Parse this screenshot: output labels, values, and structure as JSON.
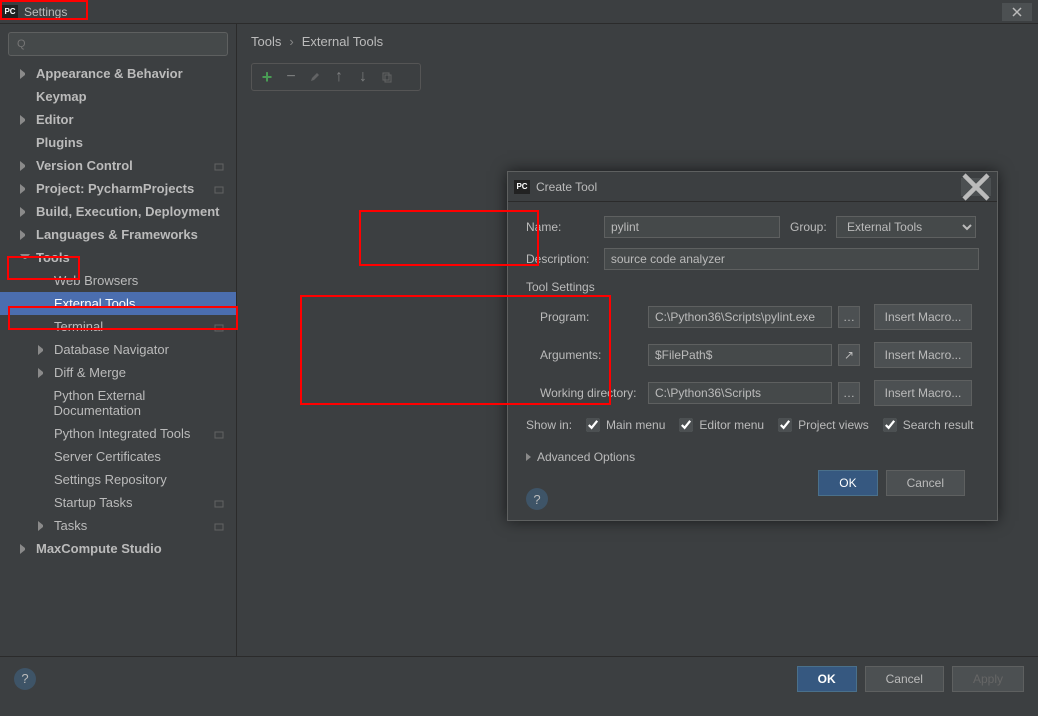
{
  "window": {
    "title": "Settings"
  },
  "sidebar": {
    "search_placeholder": "Q",
    "items": [
      {
        "label": "Appearance & Behavior",
        "bold": true,
        "arrow": "right",
        "depth": 1
      },
      {
        "label": "Keymap",
        "bold": true,
        "arrow": "none",
        "depth": 1
      },
      {
        "label": "Editor",
        "bold": true,
        "arrow": "right",
        "depth": 1
      },
      {
        "label": "Plugins",
        "bold": true,
        "arrow": "none",
        "depth": 1
      },
      {
        "label": "Version Control",
        "bold": true,
        "arrow": "right",
        "depth": 1,
        "proj": true
      },
      {
        "label": "Project: PycharmProjects",
        "bold": true,
        "arrow": "right",
        "depth": 1,
        "proj": true
      },
      {
        "label": "Build, Execution, Deployment",
        "bold": true,
        "arrow": "right",
        "depth": 1
      },
      {
        "label": "Languages & Frameworks",
        "bold": true,
        "arrow": "right",
        "depth": 1
      },
      {
        "label": "Tools",
        "bold": true,
        "arrow": "down",
        "depth": 1
      },
      {
        "label": "Web Browsers",
        "arrow": "none",
        "depth": 2
      },
      {
        "label": "External Tools",
        "arrow": "none",
        "depth": 2,
        "selected": true
      },
      {
        "label": "Terminal",
        "arrow": "none",
        "depth": 2,
        "proj": true
      },
      {
        "label": "Database Navigator",
        "arrow": "right",
        "depth": 2
      },
      {
        "label": "Diff & Merge",
        "arrow": "right",
        "depth": 2
      },
      {
        "label": "Python External Documentation",
        "arrow": "none",
        "depth": 2
      },
      {
        "label": "Python Integrated Tools",
        "arrow": "none",
        "depth": 2,
        "proj": true
      },
      {
        "label": "Server Certificates",
        "arrow": "none",
        "depth": 2
      },
      {
        "label": "Settings Repository",
        "arrow": "none",
        "depth": 2
      },
      {
        "label": "Startup Tasks",
        "arrow": "none",
        "depth": 2,
        "proj": true
      },
      {
        "label": "Tasks",
        "arrow": "right",
        "depth": 2,
        "proj": true
      },
      {
        "label": "MaxCompute Studio",
        "bold": true,
        "arrow": "right",
        "depth": 1
      }
    ]
  },
  "breadcrumb": {
    "root": "Tools",
    "leaf": "External Tools"
  },
  "dialog": {
    "title": "Create Tool",
    "name_label": "Name:",
    "name_value": "pylint",
    "group_label": "Group:",
    "group_value": "External Tools",
    "desc_label": "Description:",
    "desc_value": "source code analyzer",
    "tool_settings_hdr": "Tool Settings",
    "program_label": "Program:",
    "program_value": "C:\\Python36\\Scripts\\pylint.exe",
    "arguments_label": "Arguments:",
    "arguments_value": "$FilePath$",
    "workdir_label": "Working directory:",
    "workdir_value": "C:\\Python36\\Scripts",
    "insert_macro": "Insert Macro...",
    "showin_label": "Show in:",
    "showin_mainmenu": "Main menu",
    "showin_editormenu": "Editor menu",
    "showin_projectviews": "Project views",
    "showin_searchresult": "Search result",
    "advanced": "Advanced Options",
    "ok": "OK",
    "cancel": "Cancel"
  },
  "footer": {
    "ok": "OK",
    "cancel": "Cancel",
    "apply": "Apply"
  }
}
